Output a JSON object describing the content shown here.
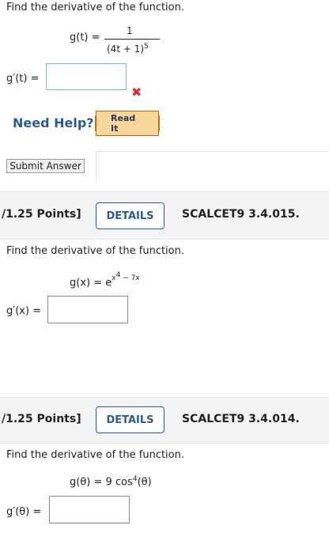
{
  "q1": {
    "prompt": "Find the derivative of the function.",
    "lhs": "g(t)",
    "eq": "=",
    "numerator": "1",
    "denominator": "(4t + 1)",
    "exponent": "5",
    "answer_label": "g′(t)",
    "answer_value": "",
    "status": "incorrect",
    "need_help": "Need Help?",
    "read_it": "Read It",
    "submit": "Submit Answer"
  },
  "q2": {
    "points": "/1.25 Points]",
    "details": "DETAILS",
    "code": "SCALCET9 3.4.015.",
    "prompt": "Find the derivative of the function.",
    "lhs": "g(x)",
    "eq": "=",
    "base": "e",
    "exp_var": "x",
    "exp_pow": "4",
    "exp_tail": " − 7x",
    "answer_label": "g′(x)",
    "answer_value": ""
  },
  "q3": {
    "points": "/1.25 Points]",
    "details": "DETAILS",
    "code": "SCALCET9 3.4.014.",
    "prompt": "Find the derivative of the function.",
    "lhs": "g(θ)",
    "eq": "=",
    "rhs_pre": "9 cos",
    "rhs_pow": "4",
    "rhs_post": "(θ)",
    "answer_label": "g′(θ)",
    "answer_value": ""
  },
  "colors": {
    "accent": "#2a5c8f",
    "error": "#d93030",
    "readit": "#f0a028"
  },
  "icons": {
    "status_icon": "close-icon"
  }
}
